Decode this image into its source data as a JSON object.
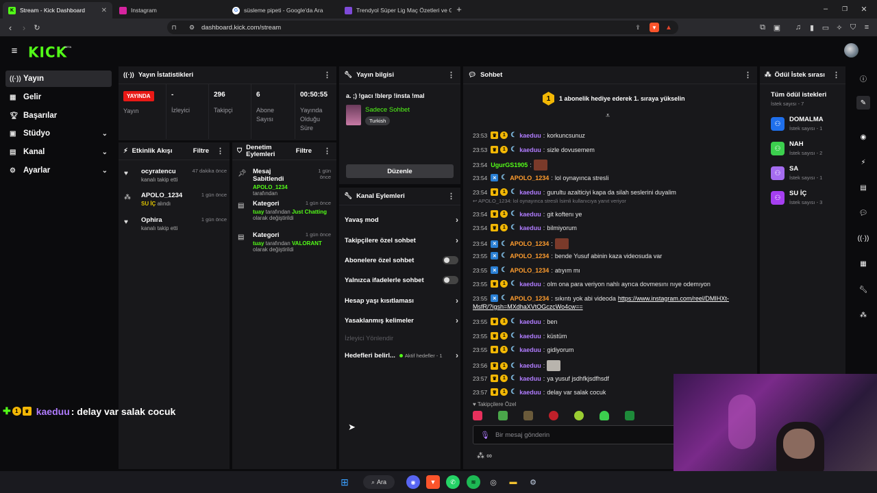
{
  "browser": {
    "tabs": [
      {
        "label": "Stream - Kick Dashboard",
        "active": true
      },
      {
        "label": "Instagram"
      },
      {
        "label": "süsleme pipeti - Google'da Ara"
      },
      {
        "label": "Trendyol Süper Lig Maç Özetleri ve G"
      }
    ],
    "url": "dashboard.kick.com/stream"
  },
  "app": {
    "logo": "KICK",
    "logo_badge": "BETA"
  },
  "sidebar": {
    "items": [
      {
        "label": "Yayın",
        "icon": "broadcast-icon"
      },
      {
        "label": "Gelir",
        "icon": "revenue-icon"
      },
      {
        "label": "Başarılar",
        "icon": "trophy-icon"
      },
      {
        "label": "Stüdyo",
        "icon": "studio-icon"
      },
      {
        "label": "Kanal",
        "icon": "channel-icon"
      },
      {
        "label": "Ayarlar",
        "icon": "settings-icon"
      }
    ]
  },
  "stats": {
    "title": "Yayın İstatistikleri",
    "live_badge": "YAYINDA",
    "live_label": "Yayın",
    "items": [
      {
        "value": "-",
        "label": "İzleyici"
      },
      {
        "value": "296",
        "label": "Takipçi"
      },
      {
        "value": "6",
        "label": "Abone Sayısı"
      },
      {
        "value": "00:50:55",
        "label": "Yayında Olduğu Süre"
      }
    ]
  },
  "stream_info": {
    "title": "Yayın bilgisi",
    "stream_title": "a. ;) !gacı !blerp !insta !mal",
    "category": "Sadece Sohbet",
    "tag": "Turkish",
    "edit_button": "Düzenle"
  },
  "activity": {
    "title": "Etkinlik Akışı",
    "filter": "Filtre",
    "items": [
      {
        "name": "ocyratencu",
        "sub": "kanalı takip etti",
        "time": "47 dakika önce"
      },
      {
        "name": "APOLO_1234",
        "sub_pre": "SU İÇ",
        "sub": " alındı",
        "time": "1 gün önce"
      },
      {
        "name": "Ophira",
        "sub": "kanalı takip etti",
        "time": "1 gün önce"
      }
    ]
  },
  "moderation": {
    "title": "Denetim Eylemleri",
    "filter": "Filtre",
    "items": [
      {
        "title": "Mesaj Sabitlendi",
        "time": "1 gün önce",
        "user": "APOLO_1234",
        "rest": " tarafından"
      },
      {
        "title": "Kategori",
        "time": "1 gün önce",
        "user": "tuay",
        "mid": " tarafından ",
        "value": "Just Chatting",
        "rest": " olarak değiştirildi"
      },
      {
        "title": "Kategori",
        "time": "1 gün önce",
        "user": "tuay",
        "mid": " tarafından ",
        "value": "VALORANT",
        "rest": " olarak değiştirildi"
      }
    ]
  },
  "channel_actions": {
    "title": "Kanal Eylemleri",
    "items": [
      {
        "label": "Yavaş mod",
        "type": "arrow"
      },
      {
        "label": "Takipçilere özel sohbet",
        "type": "arrow"
      },
      {
        "label": "Abonelere özel sohbet",
        "type": "toggle"
      },
      {
        "label": "Yalnızca ifadelerle sohbet",
        "type": "toggle"
      },
      {
        "label": "Hesap yaşı kısıtlaması",
        "type": "arrow"
      },
      {
        "label": "Yasaklanmış kelimeler",
        "type": "arrow"
      }
    ],
    "disabled_item": "İzleyici Yönlendir",
    "goals_label": "Hedefleri belirl...",
    "goals_status": "Aktif hedefler - 1"
  },
  "chat": {
    "title": "Sohbet",
    "banner_num": "1",
    "banner": "1 abonelik hediye ederek 1. sıraya yükselin",
    "reply_hint": "APOLO_1234: lol oynayınca stresli İsimli kullanıcıya yanıt veriyor",
    "messages": [
      {
        "time": "23:53",
        "user": "kaeduu",
        "badges": "sub",
        "text": "korkuncsunuz"
      },
      {
        "time": "23:53",
        "user": "kaeduu",
        "badges": "sub",
        "text": "sizle dovusemem"
      },
      {
        "time": "23:54",
        "user": "UgurGS1905",
        "badges": "none",
        "text": ""
      },
      {
        "time": "23:54",
        "user": "APOLO_1234",
        "badges": "x",
        "text": "lol oynayınca stresli"
      },
      {
        "time": "23:54",
        "user": "kaeduu",
        "badges": "sub",
        "text": "gurultu azalticiyi kapa da silah seslerini duyalim"
      },
      {
        "time": "23:54",
        "user": "kaeduu",
        "badges": "sub",
        "text": "git koftenı ye"
      },
      {
        "time": "23:54",
        "user": "kaeduu",
        "badges": "sub",
        "text": "bilmiyorum"
      },
      {
        "time": "23:54",
        "user": "APOLO_1234",
        "badges": "x",
        "text": ""
      },
      {
        "time": "23:55",
        "user": "APOLO_1234",
        "badges": "x",
        "text": "bende Yusuf abinin kaza videosuda var"
      },
      {
        "time": "23:55",
        "user": "APOLO_1234",
        "badges": "x",
        "text": "atıyım mı"
      },
      {
        "time": "23:55",
        "user": "kaeduu",
        "badges": "sub",
        "text": "olm ona para veriyon nahlı ayrıca dovmesını nıye odemıyon"
      },
      {
        "time": "23:55",
        "user": "APOLO_1234",
        "badges": "x",
        "text": "sıkıntı yok abi videoda",
        "link": "https://www.instagram.com/reel/DMIHXt-",
        "link2": "MsfR/?igsh=MXdhaXVtOGczcWo4cw=="
      },
      {
        "time": "23:55",
        "user": "kaeduu",
        "badges": "sub",
        "text": "ben"
      },
      {
        "time": "23:55",
        "user": "kaeduu",
        "badges": "sub",
        "text": "küstüm"
      },
      {
        "time": "23:55",
        "user": "kaeduu",
        "badges": "sub",
        "text": "gidiyorum"
      },
      {
        "time": "23:56",
        "user": "kaeduu",
        "badges": "sub",
        "text": ""
      },
      {
        "time": "23:57",
        "user": "kaeduu",
        "badges": "sub",
        "text": "ya yusuf jsdhfkjsdfhsdf"
      },
      {
        "time": "23:57",
        "user": "kaeduu",
        "badges": "sub",
        "text": "delay var salak cocuk"
      }
    ],
    "follower_label": "Takipçilere Özel",
    "input_placeholder": "Bir mesaj gönderin",
    "infinity": "∞"
  },
  "rewards": {
    "title": "Ödül İstek sırası",
    "all_label": "Tüm ödül istekleri",
    "all_count": "İstek sayısı - 7",
    "items": [
      {
        "name": "DOMALMA",
        "count": "İstek sayısı - 1",
        "color": "#1f6feb"
      },
      {
        "name": "NAH",
        "count": "İstek sayısı - 2",
        "color": "#3ccf4e"
      },
      {
        "name": "SA",
        "count": "İstek sayısı - 1",
        "color": "#a56cf0"
      },
      {
        "name": "SU İÇ",
        "count": "İstek sayısı - 3",
        "color": "#a53ff0"
      }
    ]
  },
  "overlay": {
    "user": "kaeduu",
    "text": " : delay var salak cocuk"
  },
  "taskbar": {
    "search": "Ara"
  },
  "colors": {
    "kick_green": "#53fc18",
    "panel": "#18181b",
    "live_red": "#e91916"
  }
}
